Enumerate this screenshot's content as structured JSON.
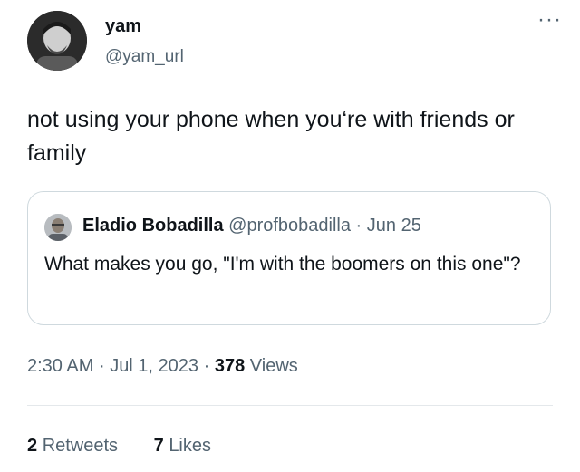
{
  "author": {
    "name": "yam",
    "handle": "@yam_url",
    "avatar_icon": "user-avatar-icon"
  },
  "more_icon": "more-horizontal-icon",
  "more_glyph": "···",
  "tweet": {
    "text": "not using your phone when you‘re with friends or family"
  },
  "quote": {
    "name": "Eladio Bobadilla",
    "handle": "@profbobadilla",
    "separator": "·",
    "date": "Jun 25",
    "text": "What makes you go, \"I'm with the boomers on this one\"?"
  },
  "meta": {
    "time": "2:30 AM",
    "sep1": "·",
    "date": "Jul 1, 2023",
    "sep2": "·",
    "views_count": "378",
    "views_label": "Views"
  },
  "stats": {
    "retweets_count": "2",
    "retweets_label": "Retweets",
    "likes_count": "7",
    "likes_label": "Likes"
  },
  "colors": {
    "text": "#0f1419",
    "secondary": "#536471",
    "border": "#cfd9de"
  }
}
